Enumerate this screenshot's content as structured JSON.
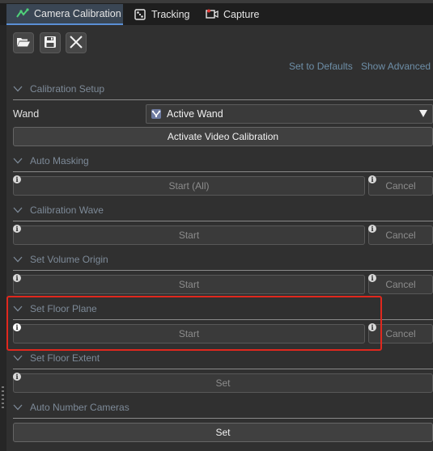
{
  "tabs": [
    {
      "label": "Camera Calibration",
      "icon": "camera-calibration-icon",
      "active": true
    },
    {
      "label": "Tracking",
      "icon": "tracking-icon",
      "active": false
    },
    {
      "label": "Capture",
      "icon": "capture-icon",
      "active": false
    }
  ],
  "toolbar": {
    "open": "folder-open-icon",
    "save": "save-icon",
    "clear": "clear-x-icon"
  },
  "links": {
    "set_defaults": "Set to Defaults",
    "show_advanced": "Show Advanced"
  },
  "sections": {
    "calibration_setup": {
      "title": "Calibration Setup",
      "wand_label": "Wand",
      "wand_value": "Active Wand",
      "activate_button": "Activate Video Calibration"
    },
    "auto_masking": {
      "title": "Auto Masking",
      "start": "Start (All)",
      "cancel": "Cancel"
    },
    "calibration_wave": {
      "title": "Calibration Wave",
      "start": "Start",
      "cancel": "Cancel"
    },
    "set_volume_origin": {
      "title": "Set Volume Origin",
      "start": "Start",
      "cancel": "Cancel"
    },
    "set_floor_plane": {
      "title": "Set Floor Plane",
      "start": "Start",
      "cancel": "Cancel"
    },
    "set_floor_extent": {
      "title": "Set Floor Extent",
      "set": "Set"
    },
    "auto_number_cameras": {
      "title": "Auto Number Cameras",
      "set": "Set"
    }
  },
  "info_glyph": "i",
  "colors": {
    "accent_tab": "#5a8fd6",
    "highlight_box": "#e0281e",
    "link": "#6e8fa8"
  }
}
